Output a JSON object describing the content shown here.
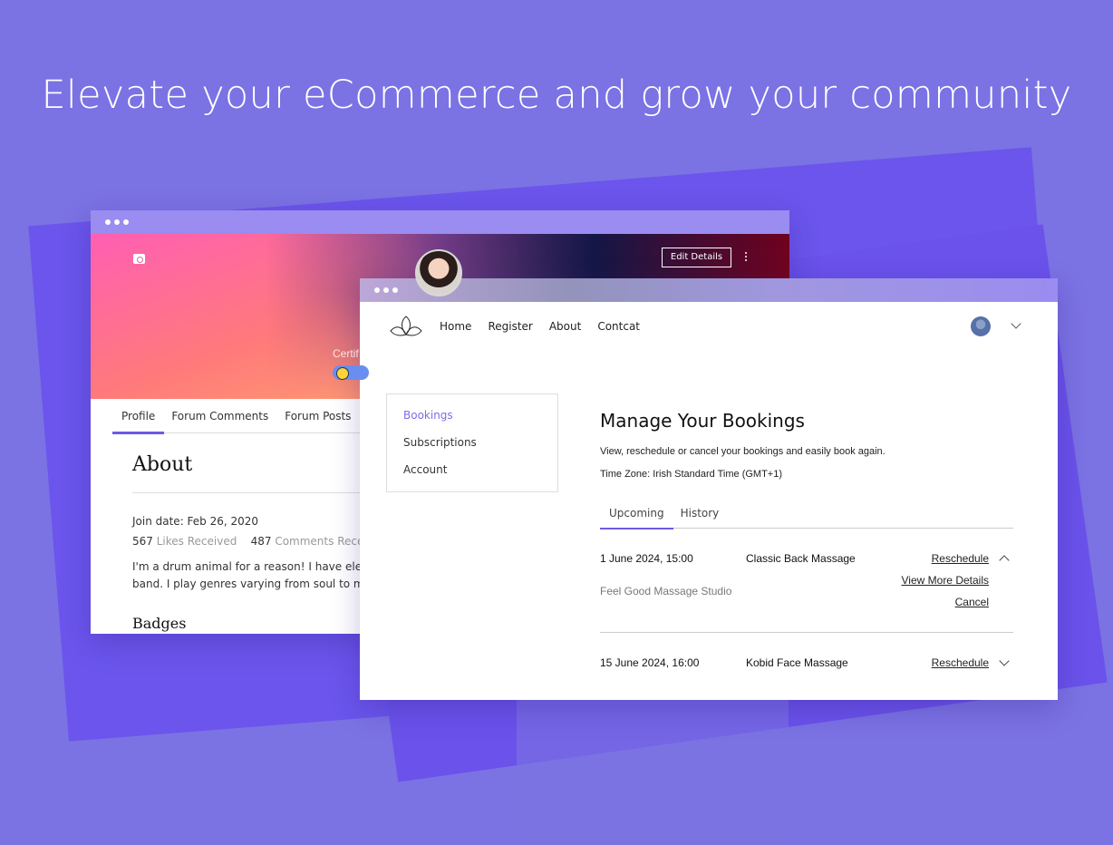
{
  "headline": "Elevate your eCommerce and grow your community",
  "profile_window": {
    "edit_button": "Edit Details",
    "cover_label": "Certif",
    "tabs": [
      {
        "label": "Profile",
        "active": true
      },
      {
        "label": "Forum Comments",
        "active": false
      },
      {
        "label": "Forum Posts",
        "active": false
      }
    ],
    "about": {
      "title": "About",
      "join_date": "Join date: Feb 26, 2020",
      "likes_count": "567",
      "likes_label": "Likes Received",
      "comments_count": "487",
      "comments_label": "Comments Received",
      "bio_line1": "I'm a drum animal for a reason! I have eleven ye",
      "bio_line2": "band. I play genres varying from soul to metal.",
      "badges_title": "Badges"
    }
  },
  "bookings_window": {
    "nav": {
      "links": [
        "Home",
        "Register",
        "About",
        "Contcat"
      ]
    },
    "sidebar": {
      "items": [
        {
          "label": "Bookings",
          "active": true
        },
        {
          "label": "Subscriptions",
          "active": false
        },
        {
          "label": "Account",
          "active": false
        }
      ]
    },
    "main": {
      "title": "Manage Your Bookings",
      "description": "View, reschedule or cancel your bookings and easily book again.",
      "timezone": "Time Zone: Irish Standard Time (GMT+1)",
      "tabs": [
        {
          "label": "Upcoming",
          "active": true
        },
        {
          "label": "History",
          "active": false
        }
      ],
      "bookings": [
        {
          "date": "1 June 2024, 15:00",
          "service": "Classic Back Massage",
          "studio": "Feel Good Massage Studio",
          "reschedule": "Reschedule",
          "view_more": "View More Details",
          "cancel": "Cancel",
          "expanded": true
        },
        {
          "date": "15 June 2024, 16:00",
          "service": "Kobid Face Massage",
          "reschedule": "Reschedule",
          "expanded": false
        }
      ]
    }
  },
  "colors": {
    "background": "#7b72e4",
    "accent": "#6b5ae6",
    "titlebar": "#9a8cf0"
  }
}
